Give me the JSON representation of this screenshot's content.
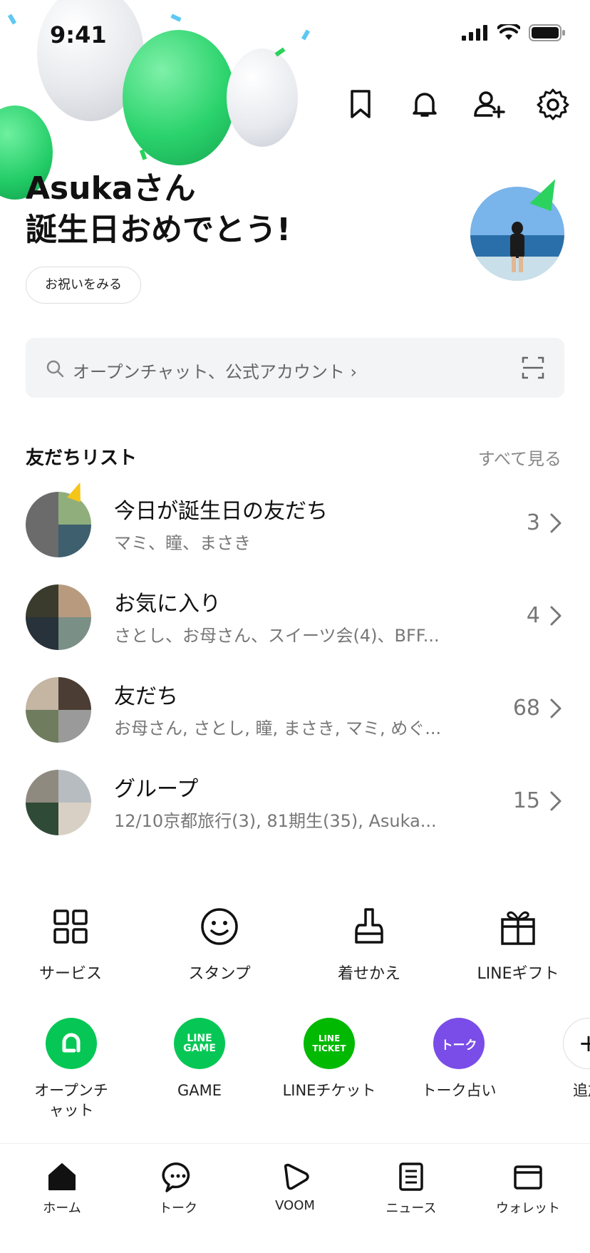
{
  "status_bar": {
    "time": "9:41"
  },
  "header": {
    "greeting_line1": "Asukaさん",
    "greeting_line2": "誕生日おめでとう!",
    "celebrate_button": "お祝いをみる"
  },
  "search": {
    "placeholder": "オープンチャット、公式アカウント ›"
  },
  "friends_section": {
    "title": "友だちリスト",
    "see_all": "すべて見る",
    "rows": [
      {
        "title": "今日が誕生日の友だち",
        "subtitle": "マミ、瞳、まさき",
        "count": "3"
      },
      {
        "title": "お気に入り",
        "subtitle": "さとし、お母さん、スイーツ会(4)、BFF...",
        "count": "4"
      },
      {
        "title": "友だち",
        "subtitle": "お母さん, さとし, 瞳, まさき, マミ, めぐ...",
        "count": "68"
      },
      {
        "title": "グループ",
        "subtitle": "12/10京都旅行(3), 81期生(35), Asuka...",
        "count": "15"
      }
    ]
  },
  "services": [
    {
      "label": "サービス",
      "icon": "grid-icon"
    },
    {
      "label": "スタンプ",
      "icon": "smiley-icon"
    },
    {
      "label": "着せかえ",
      "icon": "brush-icon"
    },
    {
      "label": "LINEギフト",
      "icon": "gift-icon"
    }
  ],
  "apps": [
    {
      "label": "オープンチャット",
      "icon": "openchat-icon",
      "color": "#06C755",
      "logo_text": ""
    },
    {
      "label": "GAME",
      "icon": "line-game-icon",
      "color": "#06C755",
      "logo_text": "LINE GAME"
    },
    {
      "label": "LINEチケット",
      "icon": "line-ticket-icon",
      "color": "#00B900",
      "logo_text": "LINE TICKET"
    },
    {
      "label": "トーク占い",
      "icon": "talk-fortune-icon",
      "color": "#7A4DE8",
      "logo_text": "トーク"
    },
    {
      "label": "追加",
      "icon": "add-icon",
      "color": "#ffffff",
      "logo_text": ""
    }
  ],
  "tabs": [
    {
      "label": "ホーム",
      "icon": "home-icon"
    },
    {
      "label": "トーク",
      "icon": "chat-icon"
    },
    {
      "label": "VOOM",
      "icon": "voom-icon"
    },
    {
      "label": "ニュース",
      "icon": "news-icon"
    },
    {
      "label": "ウォレット",
      "icon": "wallet-icon"
    }
  ],
  "colors": {
    "brand_green": "#06C755",
    "text_primary": "#111111",
    "text_secondary": "#777777",
    "search_bg": "#F3F4F6"
  }
}
